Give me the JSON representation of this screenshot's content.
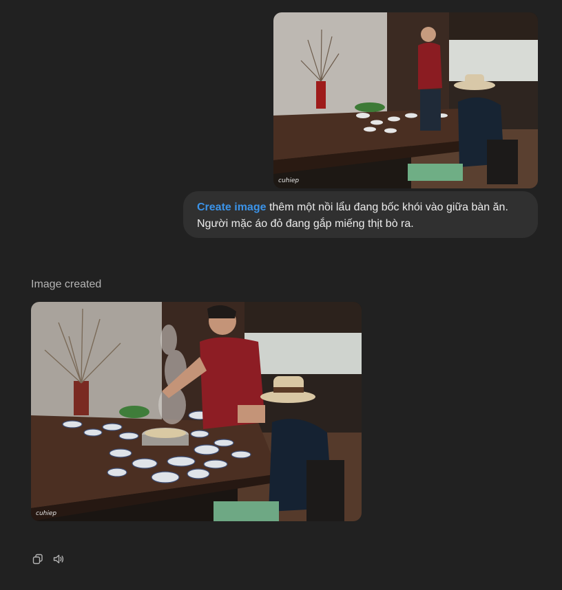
{
  "user_message": {
    "tool_tag": "Create image",
    "text": " thêm một nồi lẩu đang bốc khói vào giữa bàn ăn. Người mặc áo đỏ đang gắp miếng thịt bò ra.",
    "photo": {
      "watermark": "cuhiep"
    }
  },
  "assistant": {
    "status": "Image created",
    "photo": {
      "watermark": "cuhiep"
    }
  },
  "actions": {
    "copy_icon": "copy-icon",
    "read_aloud_icon": "speaker-icon"
  },
  "colors": {
    "background": "#212121",
    "bubble": "#303030",
    "tool_tag": "#3b93e8",
    "status_text": "#b4b4b4"
  }
}
